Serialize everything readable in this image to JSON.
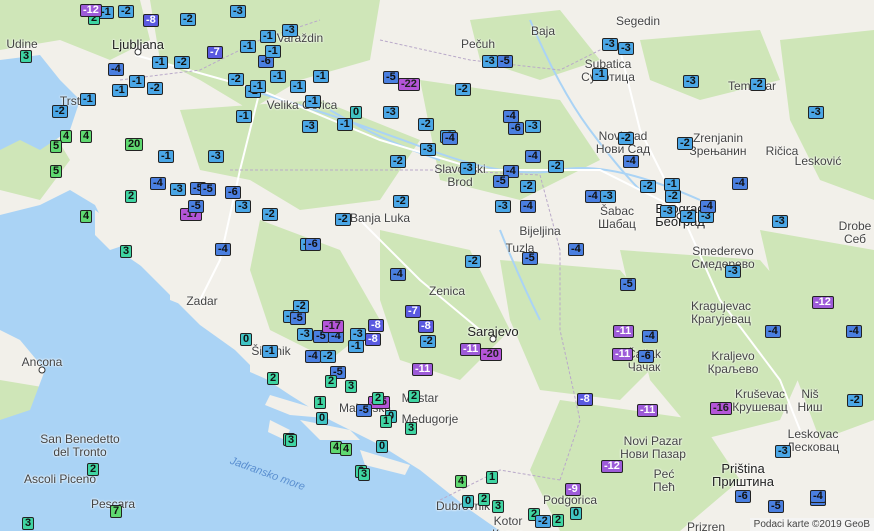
{
  "map": {
    "attribution": "Podaci karte ©2019 GeoB",
    "sea_label": "Jadransko more",
    "colors": {
      "land": "#f2f0ea",
      "forest": "#cfe6b8",
      "sea": "#aad3f5",
      "road": "#ffffff",
      "river": "#aad3f5"
    },
    "cities": [
      {
        "lines": [
          "Udine"
        ],
        "major": false,
        "dot": false
      },
      {
        "lines": [
          "Ljubljana"
        ],
        "major": true,
        "dot": true
      },
      {
        "lines": [
          "Trst"
        ],
        "major": false,
        "dot": false
      },
      {
        "lines": [
          "Pečuh"
        ],
        "major": false,
        "dot": false
      },
      {
        "lines": [
          "Baja"
        ],
        "major": false,
        "dot": false
      },
      {
        "lines": [
          "Segedin"
        ],
        "major": false,
        "dot": false
      },
      {
        "lines": [
          "Subatica",
          "Суботица"
        ],
        "major": false,
        "dot": false
      },
      {
        "lines": [
          "Temišvar"
        ],
        "major": false,
        "dot": false
      },
      {
        "lines": [
          "Novi Sad",
          "Нови Сад"
        ],
        "major": false,
        "dot": false
      },
      {
        "lines": [
          "Zrenjanin",
          "Зрењанин"
        ],
        "major": false,
        "dot": false
      },
      {
        "lines": [
          "Ričica"
        ],
        "major": false,
        "dot": false
      },
      {
        "lines": [
          "Lesković"
        ],
        "major": false,
        "dot": false
      },
      {
        "lines": [
          "Slavonski",
          "Brod"
        ],
        "major": false,
        "dot": false
      },
      {
        "lines": [
          "Banja Luka"
        ],
        "major": false,
        "dot": false
      },
      {
        "lines": [
          "Bijeljina"
        ],
        "major": false,
        "dot": false
      },
      {
        "lines": [
          "Šabac",
          "Шабац"
        ],
        "major": false,
        "dot": false
      },
      {
        "lines": [
          "Beograd",
          "Београд"
        ],
        "major": true,
        "dot": true
      },
      {
        "lines": [
          "Smederevo",
          "Смедерево"
        ],
        "major": false,
        "dot": false
      },
      {
        "lines": [
          "Drobe",
          "Себ"
        ],
        "major": false,
        "dot": false
      },
      {
        "lines": [
          "Tuzla"
        ],
        "major": false,
        "dot": false
      },
      {
        "lines": [
          "Zenica"
        ],
        "major": false,
        "dot": false
      },
      {
        "lines": [
          "Sarajevo"
        ],
        "major": true,
        "dot": true
      },
      {
        "lines": [
          "Kragujevac",
          "Крагујевац"
        ],
        "major": false,
        "dot": false
      },
      {
        "lines": [
          "Čačak",
          "Чачак"
        ],
        "major": false,
        "dot": false
      },
      {
        "lines": [
          "Kraljevo",
          "Краљево"
        ],
        "major": false,
        "dot": false
      },
      {
        "lines": [
          "Kruševac",
          "Крушевац"
        ],
        "major": false,
        "dot": false
      },
      {
        "lines": [
          "Niš",
          "Ниш"
        ],
        "major": false,
        "dot": false
      },
      {
        "lines": [
          "Leskovac",
          "Лесковац"
        ],
        "major": false,
        "dot": false
      },
      {
        "lines": [
          "Novi Pazar",
          "Нови Пазар"
        ],
        "major": false,
        "dot": false
      },
      {
        "lines": [
          "Peć",
          "Пећ"
        ],
        "major": false,
        "dot": false
      },
      {
        "lines": [
          "Priština",
          "Приштина"
        ],
        "major": true,
        "dot": false
      },
      {
        "lines": [
          "Prizren"
        ],
        "major": false,
        "dot": false
      },
      {
        "lines": [
          "Podgorica"
        ],
        "major": false,
        "dot": false
      },
      {
        "lines": [
          "Kotor",
          "Котор"
        ],
        "major": false,
        "dot": false
      },
      {
        "lines": [
          "Dubrovnik"
        ],
        "major": false,
        "dot": false
      },
      {
        "lines": [
          "Mostar"
        ],
        "major": false,
        "dot": false
      },
      {
        "lines": [
          "Makarska"
        ],
        "major": false,
        "dot": false
      },
      {
        "lines": [
          "Medugorje"
        ],
        "major": false,
        "dot": false
      },
      {
        "lines": [
          "Zadar"
        ],
        "major": false,
        "dot": false
      },
      {
        "lines": [
          "Šibenik"
        ],
        "major": false,
        "dot": false
      },
      {
        "lines": [
          "Ancona"
        ],
        "major": false,
        "dot": true
      },
      {
        "lines": [
          "San Benedetto",
          "del Tronto"
        ],
        "major": false,
        "dot": false
      },
      {
        "lines": [
          "Ascoli Piceno"
        ],
        "major": false,
        "dot": false
      },
      {
        "lines": [
          "Pescara"
        ],
        "major": false,
        "dot": false
      },
      {
        "lines": [
          "Velika Gorica"
        ],
        "major": false,
        "dot": false
      },
      {
        "lines": [
          "Varaždin"
        ],
        "major": false,
        "dot": false
      }
    ],
    "markers": [
      {
        "value": "-1"
      },
      {
        "value": "-2"
      },
      {
        "value": "2"
      },
      {
        "value": "-3"
      },
      {
        "value": "-2"
      },
      {
        "value": "-12"
      },
      {
        "value": "-8"
      },
      {
        "value": "3"
      },
      {
        "value": "-1"
      },
      {
        "value": "-2"
      },
      {
        "value": "-2"
      },
      {
        "value": "-1"
      },
      {
        "value": "-7"
      },
      {
        "value": "-1"
      },
      {
        "value": "-2"
      },
      {
        "value": "-1"
      },
      {
        "value": "-1"
      },
      {
        "value": "-4"
      },
      {
        "value": "-1"
      },
      {
        "value": "-3"
      },
      {
        "value": "-2"
      },
      {
        "value": "-6"
      },
      {
        "value": "-1"
      },
      {
        "value": "-1"
      },
      {
        "value": "-1"
      },
      {
        "value": "-1"
      },
      {
        "value": "-1"
      },
      {
        "value": "-1"
      },
      {
        "value": "-5"
      },
      {
        "value": "-22"
      },
      {
        "value": "-1"
      },
      {
        "value": "-1"
      },
      {
        "value": "0"
      },
      {
        "value": "-3"
      },
      {
        "value": "-3"
      },
      {
        "value": "-1"
      },
      {
        "value": "-2"
      },
      {
        "value": "-3"
      },
      {
        "value": "-3"
      },
      {
        "value": "-2"
      },
      {
        "value": "-3"
      },
      {
        "value": "-2"
      },
      {
        "value": "-4"
      },
      {
        "value": "-4"
      },
      {
        "value": "-3"
      },
      {
        "value": "-6"
      },
      {
        "value": "-3"
      },
      {
        "value": "-5"
      },
      {
        "value": "-2"
      },
      {
        "value": "-4"
      },
      {
        "value": "-2"
      },
      {
        "value": "-4"
      },
      {
        "value": "-5"
      },
      {
        "value": "-4"
      },
      {
        "value": "-2"
      },
      {
        "value": "-3"
      },
      {
        "value": "-3"
      },
      {
        "value": "-3"
      },
      {
        "value": "-1"
      },
      {
        "value": "-3"
      },
      {
        "value": "-2"
      },
      {
        "value": "-3"
      },
      {
        "value": "-2"
      },
      {
        "value": "-4"
      },
      {
        "value": "-2"
      },
      {
        "value": "-1"
      },
      {
        "value": "-4"
      },
      {
        "value": "-2"
      },
      {
        "value": "-4"
      },
      {
        "value": "-3"
      },
      {
        "value": "-3"
      },
      {
        "value": "-2"
      },
      {
        "value": "-3"
      },
      {
        "value": "-4"
      },
      {
        "value": "-2"
      },
      {
        "value": "-3"
      },
      {
        "value": "-3"
      },
      {
        "value": "-5"
      },
      {
        "value": "-2"
      },
      {
        "value": "-4"
      },
      {
        "value": "-5"
      },
      {
        "value": "-4"
      },
      {
        "value": "-2"
      },
      {
        "value": "-1"
      },
      {
        "value": "3"
      },
      {
        "value": "4"
      },
      {
        "value": "5"
      },
      {
        "value": "4"
      },
      {
        "value": "5"
      },
      {
        "value": "2"
      },
      {
        "value": "20"
      },
      {
        "value": "4"
      },
      {
        "value": "-1"
      },
      {
        "value": "-3"
      },
      {
        "value": "-17"
      },
      {
        "value": "-3"
      },
      {
        "value": "-4"
      },
      {
        "value": "-5"
      },
      {
        "value": "-5"
      },
      {
        "value": "-6"
      },
      {
        "value": "-2"
      },
      {
        "value": "-4"
      },
      {
        "value": "-5"
      },
      {
        "value": "-3"
      },
      {
        "value": "-6"
      },
      {
        "value": "-3"
      },
      {
        "value": "-8"
      },
      {
        "value": "-7"
      },
      {
        "value": "-8"
      },
      {
        "value": "-7"
      },
      {
        "value": "-11"
      },
      {
        "value": "-11"
      },
      {
        "value": "-20"
      },
      {
        "value": "-11"
      },
      {
        "value": "-6"
      },
      {
        "value": "-11"
      },
      {
        "value": "-4"
      },
      {
        "value": "-12"
      },
      {
        "value": "-4"
      },
      {
        "value": "-16"
      },
      {
        "value": "-11"
      },
      {
        "value": "-8"
      },
      {
        "value": "-9"
      },
      {
        "value": "-12"
      },
      {
        "value": "-4"
      },
      {
        "value": "-6"
      },
      {
        "value": "-3"
      },
      {
        "value": "-5"
      },
      {
        "value": "-4"
      },
      {
        "value": "-15"
      },
      {
        "value": "-2"
      },
      {
        "value": "-3"
      },
      {
        "value": "-1"
      },
      {
        "value": "0"
      },
      {
        "value": "2"
      },
      {
        "value": "3"
      },
      {
        "value": "2"
      },
      {
        "value": "2"
      },
      {
        "value": "0"
      },
      {
        "value": "1"
      },
      {
        "value": "2"
      },
      {
        "value": "0"
      },
      {
        "value": "1"
      },
      {
        "value": "3"
      },
      {
        "value": "4"
      },
      {
        "value": "3"
      },
      {
        "value": "0"
      },
      {
        "value": "4"
      },
      {
        "value": "2"
      },
      {
        "value": "3"
      },
      {
        "value": "2"
      },
      {
        "value": "7"
      },
      {
        "value": "3"
      },
      {
        "value": "4"
      },
      {
        "value": "0"
      },
      {
        "value": "2"
      },
      {
        "value": "1"
      },
      {
        "value": "3"
      },
      {
        "value": "2"
      },
      {
        "value": "-2"
      },
      {
        "value": "2"
      },
      {
        "value": "0"
      },
      {
        "value": "-4"
      },
      {
        "value": "-5"
      },
      {
        "value": "-2"
      },
      {
        "value": "-5"
      },
      {
        "value": "-8"
      },
      {
        "value": "-4"
      },
      {
        "value": "-5"
      },
      {
        "value": "-3"
      },
      {
        "value": "-2"
      },
      {
        "value": "-1"
      },
      {
        "value": "2"
      },
      {
        "value": "-17"
      },
      {
        "value": "-5"
      },
      {
        "value": "-4"
      },
      {
        "value": "-2"
      }
    ]
  }
}
